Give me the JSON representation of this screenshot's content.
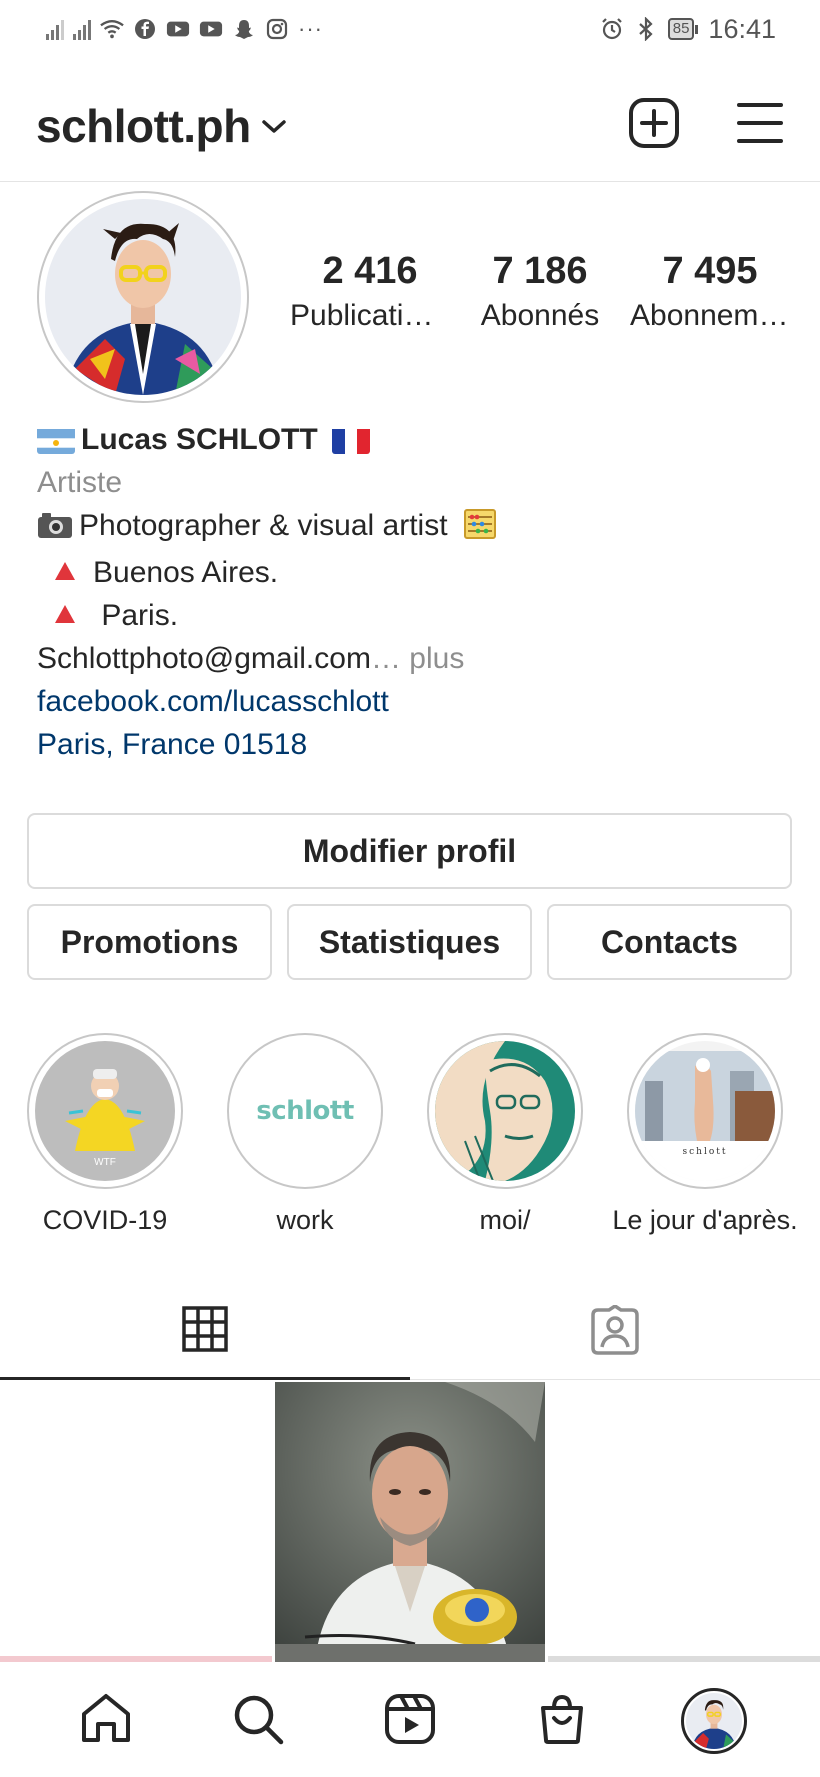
{
  "status_bar": {
    "time": "16:41",
    "battery": "85"
  },
  "header": {
    "username": "schlott.ph"
  },
  "stats": [
    {
      "value": "2 416",
      "label": "Publications"
    },
    {
      "value": "7 186",
      "label": "Abonnés"
    },
    {
      "value": "7 495",
      "label": "Abonnements"
    }
  ],
  "bio": {
    "name": "Lucas SCHLOTT",
    "category": "Artiste",
    "line1": "Photographer & visual artist",
    "line2": "Buenos Aires.",
    "line3": "Paris.",
    "email": "Schlottphoto@gmail.com",
    "more": "… plus",
    "link": "facebook.com/lucasschlott",
    "location": "Paris, France 01518"
  },
  "buttons": {
    "edit_profile": "Modifier profil",
    "promotions": "Promotions",
    "insights": "Statistiques",
    "contacts": "Contacts"
  },
  "highlights": [
    {
      "label": "COVID-19"
    },
    {
      "label": "work",
      "cover_text": "schlott"
    },
    {
      "label": "moi/"
    },
    {
      "label": "Le jour d'après.",
      "cover_text": "schlott"
    }
  ],
  "icons": {
    "header": [
      "chevron-down-icon",
      "new-post-icon",
      "menu-icon"
    ],
    "tabs": [
      "grid-icon",
      "tagged-icon"
    ],
    "nav": [
      "home-icon",
      "search-icon",
      "reels-icon",
      "shop-icon",
      "profile-avatar"
    ]
  },
  "colors": {
    "link": "#00376b",
    "secondary_text": "#8e8e8e",
    "border": "#dbdbdb",
    "text": "#262626"
  }
}
